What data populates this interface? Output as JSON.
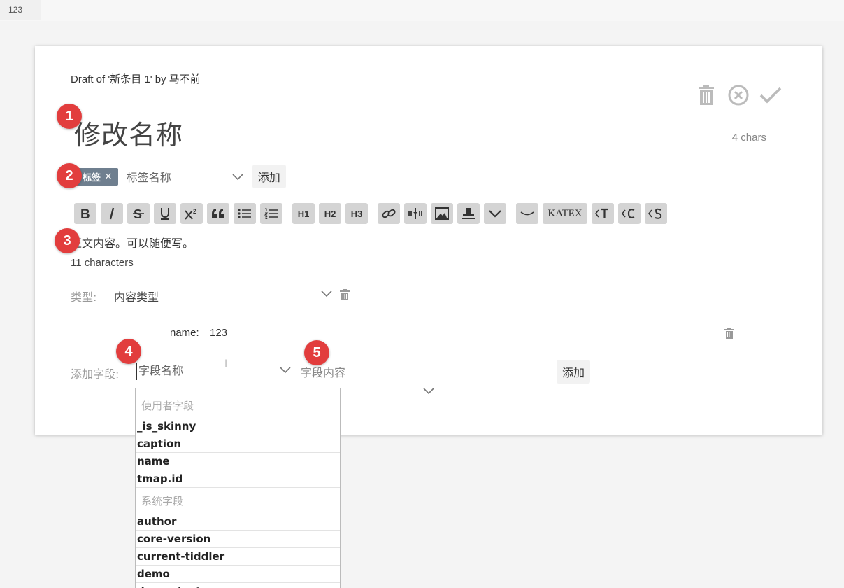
{
  "tab": {
    "label": "123"
  },
  "draft": {
    "title": "Draft of '新条目 1' by 马不前",
    "name": "修改名称",
    "name_count": "4 chars"
  },
  "tags": {
    "existing": "标签",
    "remove_glyph": "×",
    "input_placeholder": "标签名称",
    "add_label": "添加"
  },
  "editor": {
    "toolbar": {
      "h1": "H1",
      "h2": "H2",
      "h3": "H3",
      "katex": "KATEX"
    },
    "text": "正文内容。可以随便写。",
    "count": "11 characters"
  },
  "type": {
    "label": "类型:",
    "placeholder": "内容类型"
  },
  "fields": [
    {
      "name": "name:",
      "value": "123"
    }
  ],
  "add_field": {
    "label": "添加字段:",
    "name_placeholder": "字段名称",
    "value_placeholder": "字段内容",
    "add_label": "添加"
  },
  "dropdown": {
    "group1": "使用者字段",
    "user_fields": [
      "_is_skinny",
      "caption",
      "name",
      "tmap.id"
    ],
    "group2": "系统字段",
    "system_fields": [
      "author",
      "core-version",
      "current-tiddler",
      "demo",
      "dependents"
    ]
  },
  "badges": [
    "1",
    "2",
    "3",
    "4",
    "5"
  ],
  "colors": {
    "badge": "#e23d3d",
    "tag": "#6f7f8f",
    "toolbar_button": "#d4d4d4"
  }
}
